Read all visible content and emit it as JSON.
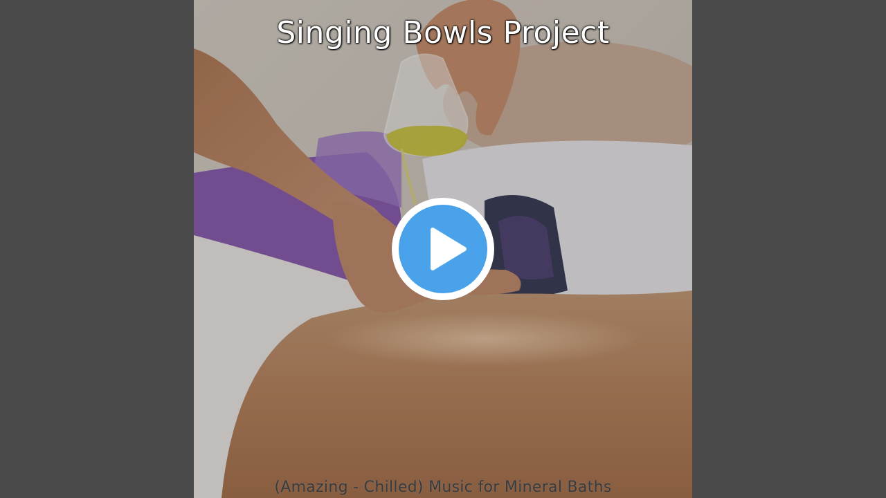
{
  "player": {
    "channel_title": "Singing Bowls Project",
    "track_title": "(Amazing - Chilled) Music for Mineral Baths",
    "play_icon": "play-icon",
    "colors": {
      "background": "#4a4a4a",
      "play_button_fill": "#4aa3ea",
      "play_button_ring": "#ffffff"
    }
  }
}
